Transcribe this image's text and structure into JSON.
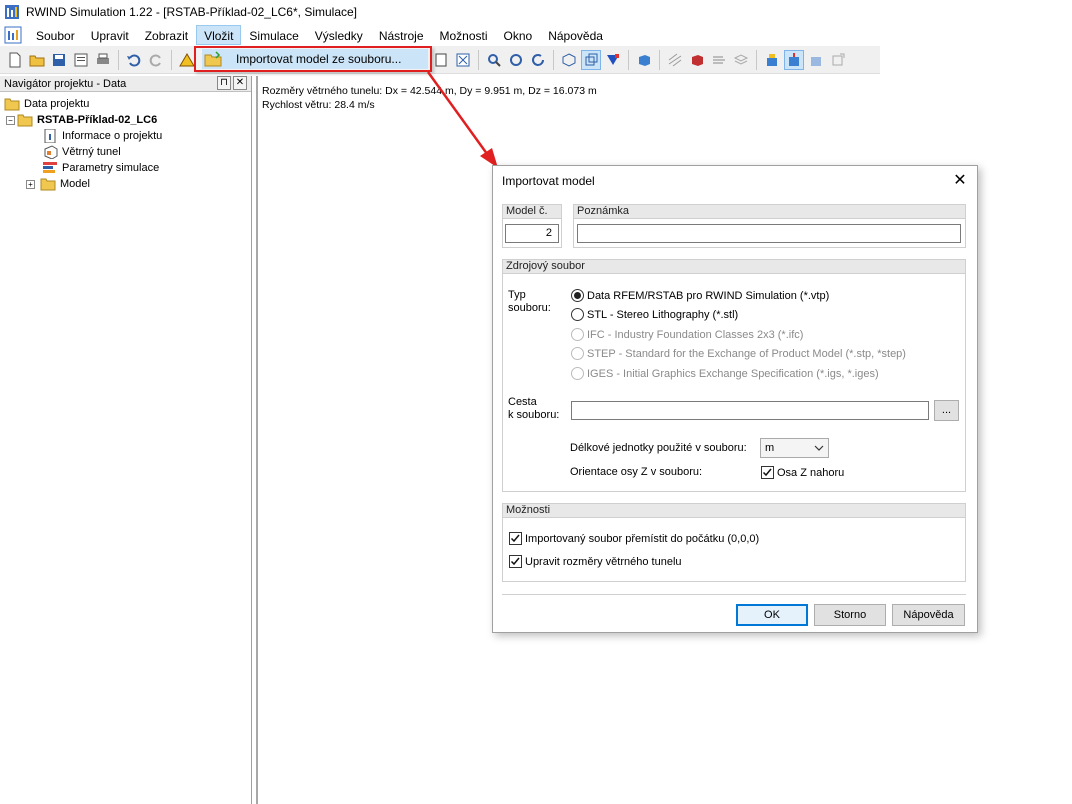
{
  "window": {
    "title": "RWIND Simulation 1.22 - [RSTAB-Příklad-02_LC6*, Simulace]"
  },
  "menu": {
    "items": [
      {
        "label": "Soubor"
      },
      {
        "label": "Upravit"
      },
      {
        "label": "Zobrazit"
      },
      {
        "label": "Vložit"
      },
      {
        "label": "Simulace"
      },
      {
        "label": "Výsledky"
      },
      {
        "label": "Nástroje"
      },
      {
        "label": "Možnosti"
      },
      {
        "label": "Okno"
      },
      {
        "label": "Nápověda"
      }
    ],
    "dropdown_item": "Importovat model ze souboru..."
  },
  "navigator": {
    "title": "Navigátor projektu - Data",
    "pin_glyph": "⊓",
    "close_glyph": "✕",
    "root": "Data projektu",
    "project": "RSTAB-Příklad-02_LC6",
    "children": [
      "Informace o projektu",
      "Větrný tunel",
      "Parametry simulace",
      "Model"
    ]
  },
  "viewport": {
    "line1": "Rozměry větrného tunelu: Dx = 42.544 m, Dy = 9.951 m, Dz = 16.073 m",
    "line2": "Rychlost větru: 28.4 m/s"
  },
  "dialog": {
    "title": "Importovat model",
    "close_glyph": "✕",
    "model_no_label": "Model č.",
    "model_no_value": "2",
    "note_label": "Poznámka",
    "note_value": "",
    "source_group": "Zdrojový soubor",
    "file_type_label_1": "Typ",
    "file_type_label_2": "souboru:",
    "file_types": [
      {
        "label": "Data RFEM/RSTAB pro RWIND Simulation (*.vtp)"
      },
      {
        "label": "STL - Stereo Lithography (*.stl)"
      },
      {
        "label": "IFC - Industry Foundation Classes 2x3 (*.ifc)"
      },
      {
        "label": "STEP - Standard for the Exchange of Product Model (*.stp, *step)"
      },
      {
        "label": "IGES - Initial Graphics Exchange Specification (*.igs, *.iges)"
      }
    ],
    "path_label_1": "Cesta",
    "path_label_2": "k souboru:",
    "path_value": "",
    "browse_label": "...",
    "units_label": "Délkové jednotky použité v souboru:",
    "units_value": "m",
    "z_axis_label": "Orientace osy Z v souboru:",
    "z_axis_check": "Osa Z nahoru",
    "options_group": "Možnosti",
    "option_move": "Importovaný soubor přemístit do počátku (0,0,0)",
    "option_resize": "Upravit rozměry větrného tunelu",
    "ok_label": "OK",
    "cancel_label": "Storno",
    "help_label": "Nápověda"
  },
  "colors": {
    "highlight": "#e02020",
    "selection": "#cce4f7",
    "default_button": "#0078d7"
  }
}
